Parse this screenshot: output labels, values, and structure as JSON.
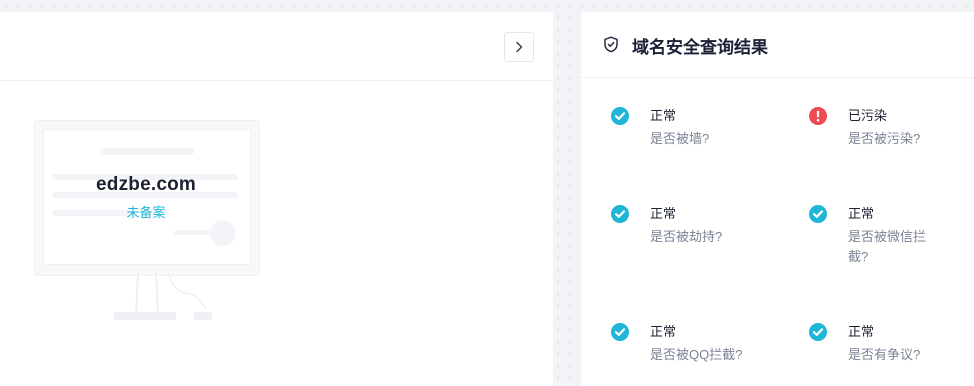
{
  "left": {
    "domain": "edzbe.com",
    "icp_status": "未备案",
    "expand_button_icon": "chevron-right-icon"
  },
  "right": {
    "title": "域名安全查询结果",
    "title_icon": "shield-check-icon",
    "results": [
      {
        "status": "正常",
        "question": "是否被墙?",
        "state": "ok"
      },
      {
        "status": "已污染",
        "question": "是否被污染?",
        "state": "alert"
      },
      {
        "status": "正常",
        "question": "是否被劫持?",
        "state": "ok"
      },
      {
        "status": "正常",
        "question": "是否被微信拦截?",
        "state": "ok"
      },
      {
        "status": "正常",
        "question": "是否被QQ拦截?",
        "state": "ok"
      },
      {
        "status": "正常",
        "question": "是否有争议?",
        "state": "ok"
      }
    ]
  },
  "colors": {
    "ok": "#1fb5d6",
    "alert": "#ef4b52",
    "accent": "#1fb5d6"
  }
}
